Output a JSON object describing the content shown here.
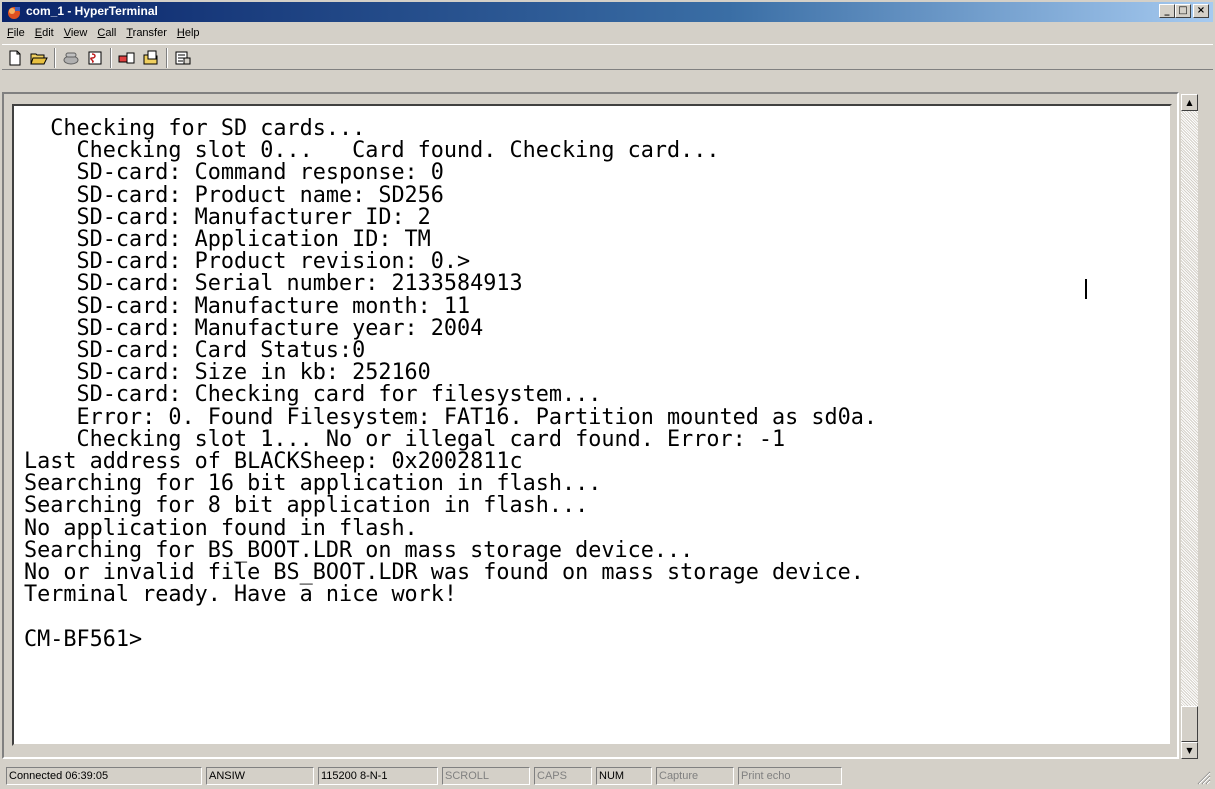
{
  "window": {
    "title": "com_1 - HyperTerminal"
  },
  "menu": [
    {
      "label": "File",
      "accel": "F",
      "rest": "ile"
    },
    {
      "label": "Edit",
      "accel": "E",
      "rest": "dit"
    },
    {
      "label": "View",
      "accel": "V",
      "rest": "iew"
    },
    {
      "label": "Call",
      "accel": "C",
      "rest": "all"
    },
    {
      "label": "Transfer",
      "accel": "T",
      "rest": "ransfer"
    },
    {
      "label": "Help",
      "accel": "H",
      "rest": "elp"
    }
  ],
  "toolbar": {
    "icons": [
      "new-document-icon",
      "open-folder-icon",
      "phone-connect-icon",
      "disconnect-icon",
      "send-file-icon",
      "receive-file-icon",
      "properties-icon"
    ]
  },
  "terminal": {
    "text": "  Checking for SD cards...\n    Checking slot 0...   Card found. Checking card...\n    SD-card: Command response: 0\n    SD-card: Product name: SD256\n    SD-card: Manufacturer ID: 2\n    SD-card: Application ID: TM\n    SD-card: Product revision: 0.>\n    SD-card: Serial number: 2133584913\n    SD-card: Manufacture month: 11\n    SD-card: Manufacture year: 2004\n    SD-card: Card Status:0\n    SD-card: Size in kb: 252160\n    SD-card: Checking card for filesystem...\n    Error: 0. Found Filesystem: FAT16. Partition mounted as sd0a.\n    Checking slot 1... No or illegal card found. Error: -1\nLast address of BLACKSheep: 0x2002811c\nSearching for 16 bit application in flash...\nSearching for 8 bit application in flash...\nNo application found in flash.\nSearching for BS_BOOT.LDR on mass storage device...\nNo or invalid file BS_BOOT.LDR was found on mass storage device.\nTerminal ready. Have a nice work!\n\nCM-BF561>"
  },
  "status": {
    "connected": "Connected 06:39:05",
    "emulation": "ANSIW",
    "port_settings": "115200 8-N-1",
    "scroll": "SCROLL",
    "caps": "CAPS",
    "num": "NUM",
    "capture": "Capture",
    "print_echo": "Print echo"
  },
  "colors": {
    "title_start": "#0a246a",
    "title_end": "#a6caf0",
    "face": "#d4d0c8"
  }
}
